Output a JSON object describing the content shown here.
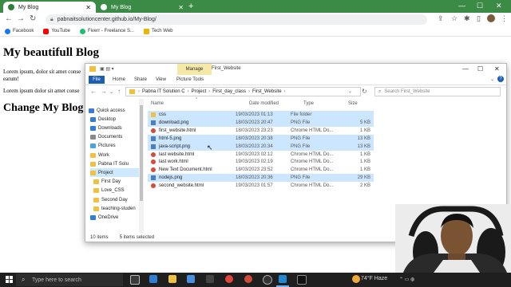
{
  "browser": {
    "tabs": [
      {
        "label": "My Blog",
        "active": true
      },
      {
        "label": "My Blog",
        "active": false
      }
    ],
    "new_tab": "+",
    "url": "pabnaitsolutioncenter.github.io/My-Blog/",
    "bookmarks": [
      "Facebook",
      "YouTube",
      "Fiverr - Freelance S...",
      "Tech Web"
    ],
    "colors": {
      "accent": "#3b8a46"
    }
  },
  "page": {
    "title": "My beautifull Blog",
    "para1_line1": "Lorem ipsum, dolor sit amet conse",
    "para1_line2": "earum!",
    "para2": "Lorem ipsum dolor sit amet conse",
    "heading2": "Change My Blog"
  },
  "explorer": {
    "manage_label": "Manage",
    "window_title": "First_Website",
    "ribbon": {
      "file": "File",
      "home": "Home",
      "share": "Share",
      "view": "View",
      "picture_tools": "Picture Tools"
    },
    "breadcrumb": [
      "Pabna IT Solution C",
      "Project",
      "First_day_class",
      "First_Website"
    ],
    "search_placeholder": "Search First_Website",
    "nav": [
      {
        "label": "Quick access",
        "selected": false
      },
      {
        "label": "Desktop",
        "selected": false
      },
      {
        "label": "Downloads",
        "selected": false
      },
      {
        "label": "Documents",
        "selected": false
      },
      {
        "label": "Pictures",
        "selected": false
      },
      {
        "label": "Work",
        "selected": false
      },
      {
        "label": "Pabna IT Solu",
        "selected": false
      },
      {
        "label": "Project",
        "selected": true
      },
      {
        "label": "First Day",
        "selected": false
      },
      {
        "label": "Love_CSS",
        "selected": false
      },
      {
        "label": "Second Day",
        "selected": false
      },
      {
        "label": "teaching-studen",
        "selected": false
      },
      {
        "label": "OneDrive",
        "selected": false
      }
    ],
    "columns": {
      "name": "Name",
      "date": "Date modified",
      "type": "Type",
      "size": "Size"
    },
    "files": [
      {
        "name": "css",
        "date": "19/03/2023 01:13",
        "type": "File folder",
        "size": "",
        "kind": "folder",
        "selected": true
      },
      {
        "name": "download.png",
        "date": "18/03/2023 20:47",
        "type": "PNG File",
        "size": "5 KB",
        "kind": "png",
        "selected": true
      },
      {
        "name": "first_website.html",
        "date": "18/03/2023 23:23",
        "type": "Chrome HTML Do...",
        "size": "1 KB",
        "kind": "html",
        "selected": false
      },
      {
        "name": "html-5.png",
        "date": "18/03/2023 20:38",
        "type": "PNG File",
        "size": "13 KB",
        "kind": "png",
        "selected": true
      },
      {
        "name": "java-script.png",
        "date": "18/03/2023 20:34",
        "type": "PNG File",
        "size": "13 KB",
        "kind": "png",
        "selected": true
      },
      {
        "name": "last website.html",
        "date": "19/03/2023 02:12",
        "type": "Chrome HTML Do...",
        "size": "1 KB",
        "kind": "html",
        "selected": false
      },
      {
        "name": "last work.html",
        "date": "19/03/2023 02:19",
        "type": "Chrome HTML Do...",
        "size": "1 KB",
        "kind": "html",
        "selected": false
      },
      {
        "name": "New Text Document.html",
        "date": "18/03/2023 23:52",
        "type": "Chrome HTML Do...",
        "size": "1 KB",
        "kind": "html",
        "selected": false
      },
      {
        "name": "nodejs.png",
        "date": "18/03/2023 20:36",
        "type": "PNG File",
        "size": "29 KB",
        "kind": "png",
        "selected": true
      },
      {
        "name": "second_website.html",
        "date": "19/03/2023 01:57",
        "type": "Chrome HTML Do...",
        "size": "2 KB",
        "kind": "html",
        "selected": false
      }
    ],
    "status_items": "10 items",
    "status_selected": "5 items selected"
  },
  "taskbar": {
    "search_placeholder": "Type here to search",
    "weather": "74°F Haze"
  }
}
